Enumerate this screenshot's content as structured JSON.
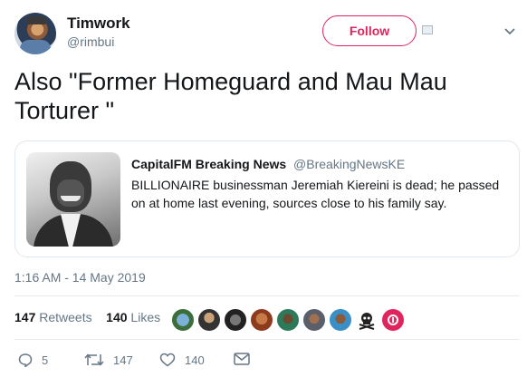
{
  "author": {
    "name": "Timwork",
    "handle": "@rimbui"
  },
  "follow_label": "Follow",
  "tweet_text": "Also \"Former Homeguard and Mau Mau Torturer \"",
  "quoted": {
    "name": "CapitalFM Breaking News",
    "handle": "@BreakingNewsKE",
    "text": "BILLIONAIRE businessman Jeremiah Kiereini is dead; he passed on at home last evening, sources close to his family say."
  },
  "timestamp": "1:16 AM - 14 May 2019",
  "stats": {
    "retweets_count": "147",
    "retweets_label": "Retweets",
    "likes_count": "140",
    "likes_label": "Likes"
  },
  "actions": {
    "replies": "5",
    "retweets": "147",
    "likes": "140"
  },
  "icons": {
    "reply": "reply-icon",
    "retweet": "retweet-icon",
    "like": "heart-icon",
    "dm": "envelope-icon",
    "more": "chevron-down-icon"
  },
  "colors": {
    "accent": "#e0245e",
    "muted": "#657786",
    "text": "#14171a",
    "border": "#e1e8ed"
  }
}
